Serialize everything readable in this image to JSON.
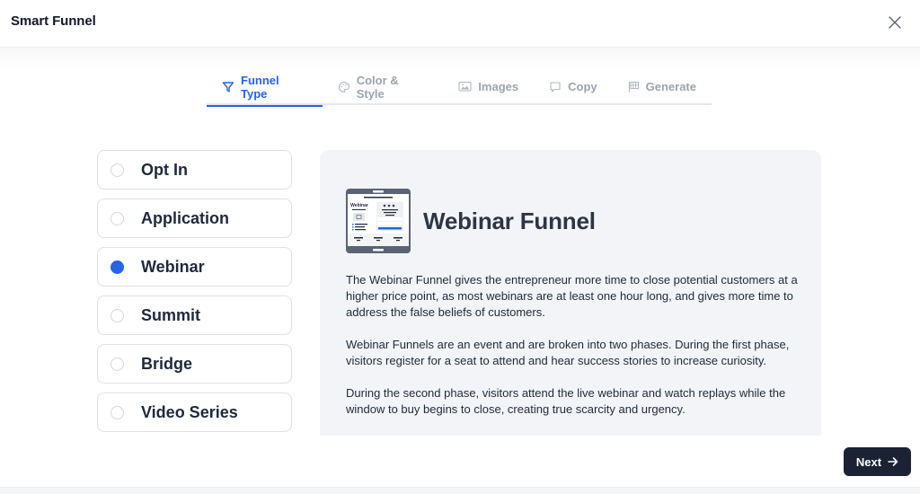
{
  "header": {
    "title": "Smart Funnel",
    "close_icon": "close-icon"
  },
  "tabs": [
    {
      "label": "Funnel Type",
      "icon": "funnel-icon",
      "active": true
    },
    {
      "label": "Color & Style",
      "icon": "palette-icon",
      "active": false
    },
    {
      "label": "Images",
      "icon": "image-icon",
      "active": false
    },
    {
      "label": "Copy",
      "icon": "chat-bubble-icon",
      "active": false
    },
    {
      "label": "Generate",
      "icon": "flag-icon",
      "active": false
    }
  ],
  "options": [
    {
      "label": "Opt In",
      "selected": false
    },
    {
      "label": "Application",
      "selected": false
    },
    {
      "label": "Webinar",
      "selected": true
    },
    {
      "label": "Summit",
      "selected": false
    },
    {
      "label": "Bridge",
      "selected": false
    },
    {
      "label": "Video Series",
      "selected": false
    }
  ],
  "detail": {
    "title": "Webinar Funnel",
    "illustration_label": "Webinar",
    "paragraphs": [
      "The Webinar Funnel gives the entrepreneur more time to close potential customers at a higher price point, as most webinars are at least one hour long, and gives more time to address the false beliefs of customers.",
      "Webinar Funnels are an event and are broken into two phases. During the first phase, visitors register for a seat to attend and hear success stories to increase curiosity.",
      "During the second phase, visitors attend the live webinar and watch replays while the window to buy begins to close, creating true scarcity and urgency."
    ]
  },
  "footer": {
    "next_label": "Next",
    "next_icon": "arrow-right-icon"
  },
  "colors": {
    "accent": "#2563eb",
    "primary_button": "#1a2233",
    "panel_bg": "#f3f4f8",
    "tab_inactive": "#9ca3af"
  }
}
